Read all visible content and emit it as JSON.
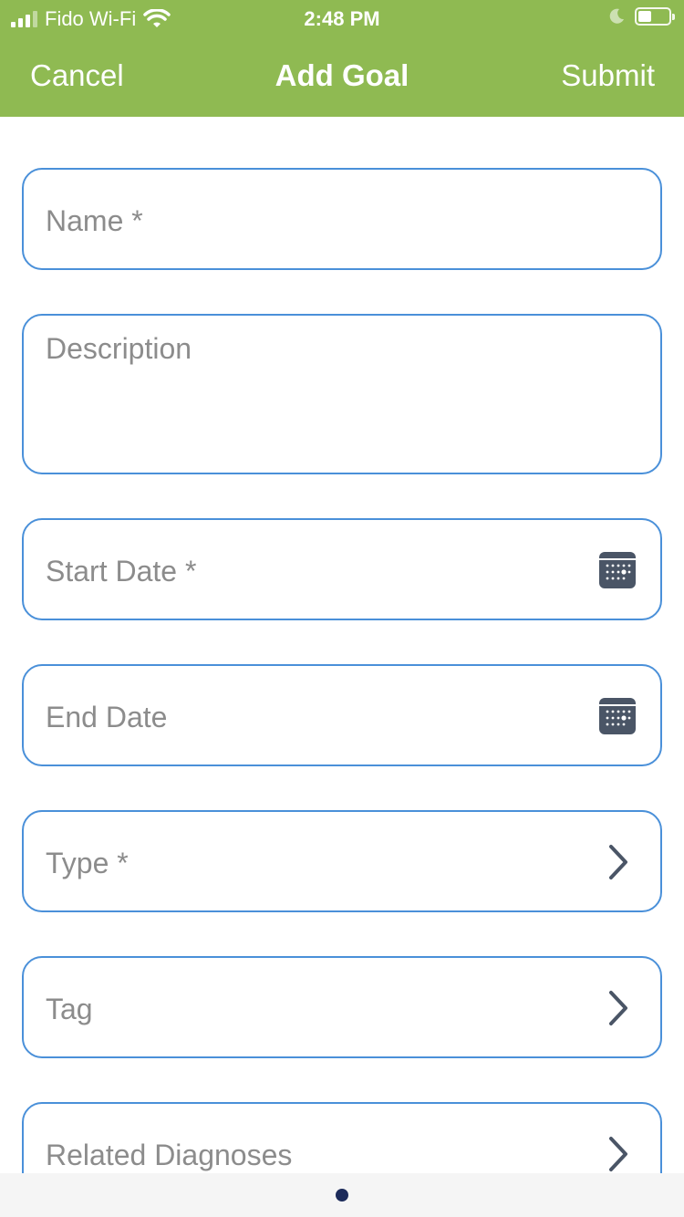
{
  "status_bar": {
    "carrier": "Fido Wi-Fi",
    "time": "2:48 PM",
    "icons": [
      "signal-icon",
      "wifi-icon",
      "moon-icon",
      "battery-icon"
    ]
  },
  "nav": {
    "cancel_label": "Cancel",
    "title": "Add Goal",
    "submit_label": "Submit"
  },
  "form": {
    "name_placeholder": "Name *",
    "description_placeholder": "Description",
    "start_date_placeholder": "Start Date *",
    "end_date_placeholder": "End Date",
    "type_placeholder": "Type *",
    "tag_placeholder": "Tag",
    "related_diagnoses_placeholder": "Related Diagnoses"
  },
  "colors": {
    "header": "#8fba52",
    "field_border": "#4a90d9",
    "placeholder": "#8c8c8c",
    "icon": "#4a5566",
    "page_dot": "#1c2b5a"
  }
}
